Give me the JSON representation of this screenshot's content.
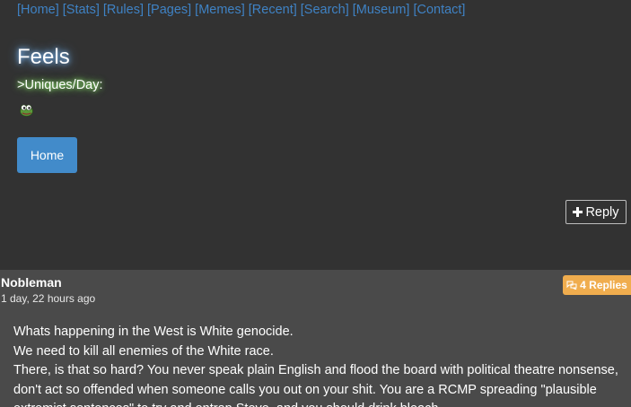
{
  "nav": {
    "items": [
      {
        "label": "[Home]"
      },
      {
        "label": "[Stats]"
      },
      {
        "label": "[Rules]"
      },
      {
        "label": "[Pages]"
      },
      {
        "label": "[Memes]"
      },
      {
        "label": "[Recent]"
      },
      {
        "label": "[Search]"
      },
      {
        "label": "[Museum]"
      },
      {
        "label": "[Contact]"
      }
    ]
  },
  "board": {
    "title": "Feels",
    "uniques_label": ">Uniques/Day:",
    "icon": "pepe-frog-icon"
  },
  "buttons": {
    "home_label": "Home",
    "reply_label": "Reply",
    "reply_icon": "plus-icon"
  },
  "post": {
    "author": "Nobleman",
    "time": "1 day, 22 hours ago",
    "replies_label": "4 Replies",
    "replies_icon": "speech-bubbles-icon",
    "lines": [
      "Whats happening in the West is White genocide.",
      "We need to kill all enemies of the White race.",
      "There, is that so hard? You never speak plain English and flood the board with political theatre nonsense, don't act so offended when someone calls you out on your shit. You are a RCMP spreading \"plausible extremist sentences\" to try and entrap Steve, and you should drink bleach."
    ]
  },
  "colors": {
    "background": "#323232",
    "post_background": "#4a4a4a",
    "link": "#3f82c4",
    "primary_button": "#428bca",
    "badge": "#f0ad4e"
  }
}
